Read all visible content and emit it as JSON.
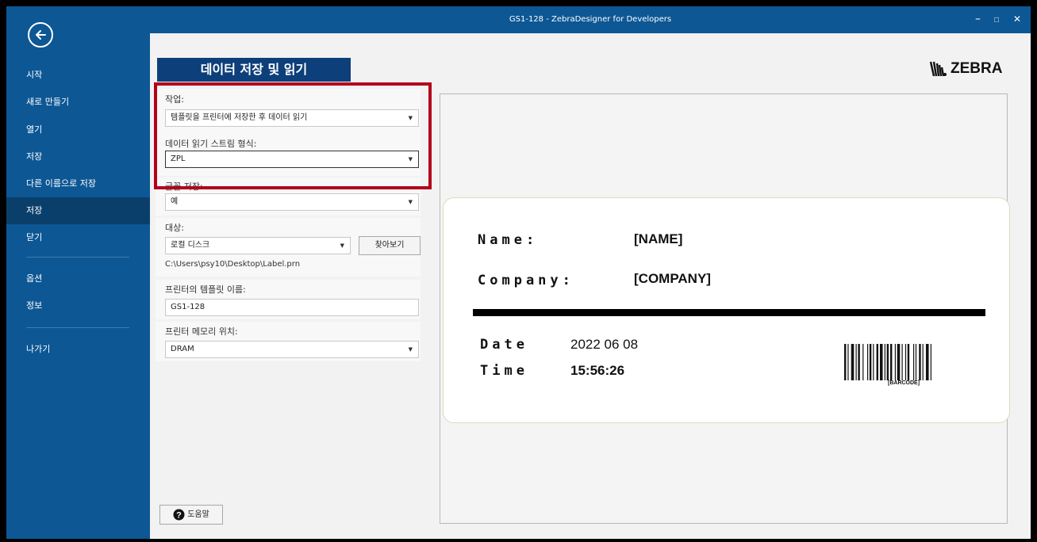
{
  "window": {
    "title": "GS1-128 - ZebraDesigner for Developers",
    "minimize": "–",
    "restore": "▫",
    "close": "✕"
  },
  "sidebar": {
    "back_icon": "arrow-left-circle-icon",
    "items": [
      {
        "label": "시작"
      },
      {
        "label": "새로 만들기"
      },
      {
        "label": "열기"
      },
      {
        "label": "저장"
      },
      {
        "label": "다른 이름으로 저장"
      },
      {
        "label": "저장"
      },
      {
        "label": "닫기"
      },
      {
        "label": "옵션"
      },
      {
        "label": "정보"
      },
      {
        "label": "나가기"
      }
    ]
  },
  "main": {
    "heading": "데이터 저장 및 읽기",
    "logo_text": "ZEBRA",
    "task": {
      "label": "작업:",
      "value": "템플릿을 프린터에 저장한 후 데이터 읽기"
    },
    "stream_format": {
      "label": "데이터 읽기 스트림 형식:",
      "value": "ZPL"
    },
    "font_save": {
      "label": "글꼴 저장:",
      "value": "예"
    },
    "target": {
      "label": "대상:",
      "value": "로컬 디스크",
      "browse": "찾아보기",
      "path": "C:\\Users\\psy10\\Desktop\\Label.prn"
    },
    "template_name": {
      "label": "프린터의 템플릿 이름:",
      "value": "GS1-128"
    },
    "memory": {
      "label": "프린터 메모리 위치:",
      "value": "DRAM"
    },
    "help": "도움말"
  },
  "label_preview": {
    "name_key": "Name:",
    "name_val": "[NAME]",
    "company_key": "Company:",
    "company_val": "[COMPANY]",
    "date_key": "Date",
    "date_val": "2022 06 08",
    "time_key": "Time",
    "time_val": "15:56:26",
    "barcode_text": "[BARCODE]"
  },
  "colors": {
    "sidebar": "#0d5794",
    "heading": "#0d3f7a",
    "highlight": "#b3001b"
  }
}
